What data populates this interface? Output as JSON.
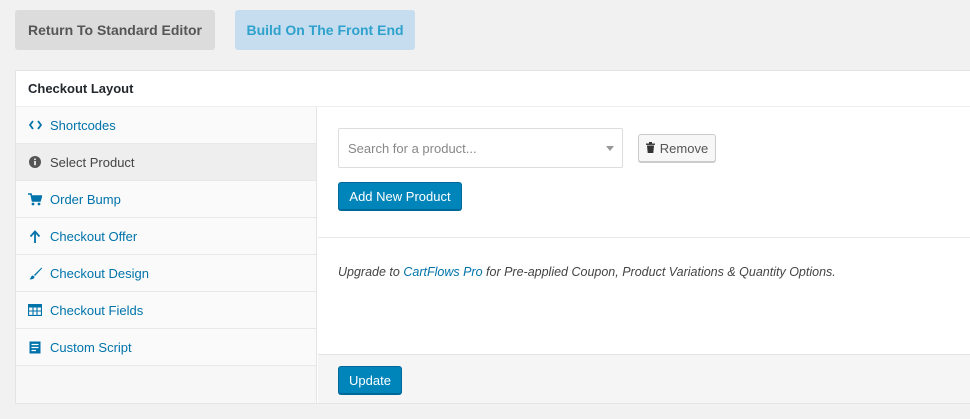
{
  "top_buttons": {
    "standard_editor": "Return To Standard Editor",
    "front_end": "Build On The Front End"
  },
  "panel": {
    "title": "Checkout Layout",
    "sidebar": {
      "items": [
        {
          "label": "Shortcodes",
          "icon": "code-icon"
        },
        {
          "label": "Select Product",
          "icon": "info-icon",
          "active": true
        },
        {
          "label": "Order Bump",
          "icon": "cart-icon"
        },
        {
          "label": "Checkout Offer",
          "icon": "arrow-up-icon"
        },
        {
          "label": "Checkout Design",
          "icon": "brush-icon"
        },
        {
          "label": "Checkout Fields",
          "icon": "table-icon"
        },
        {
          "label": "Custom Script",
          "icon": "document-icon"
        }
      ]
    },
    "product": {
      "search_placeholder": "Search for a product...",
      "remove_label": "Remove",
      "add_label": "Add New Product"
    },
    "upgrade": {
      "prefix": "Upgrade to",
      "link": "CartFlows Pro",
      "suffix": "for Pre-applied Coupon, Product Variations & Quantity Options."
    },
    "update_label": "Update"
  },
  "colors": {
    "accent": "#0085ba",
    "link": "#0073aa",
    "front_end_bg": "#c5ddef",
    "front_end_text": "#2ea2cc"
  }
}
